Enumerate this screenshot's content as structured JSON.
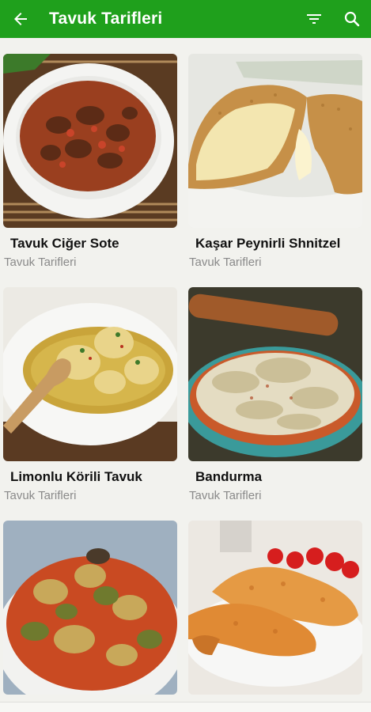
{
  "app_bar": {
    "title": "Tavuk Tarifleri",
    "background": "#1fa01c",
    "back_icon": "arrow-left-icon",
    "filter_icon": "filter-icon",
    "search_icon": "search-icon"
  },
  "recipes": [
    {
      "title": "Tavuk Ciğer Sote",
      "category": "Tavuk Tarifleri",
      "image": "liver-saute-photo"
    },
    {
      "title": "Kaşar Peynirli Shnitzel",
      "category": "Tavuk Tarifleri",
      "image": "cheese-schnitzel-photo"
    },
    {
      "title": "Limonlu Körili Tavuk",
      "category": "Tavuk Tarifleri",
      "image": "lemon-curry-chicken-photo"
    },
    {
      "title": "Bandurma",
      "category": "Tavuk Tarifleri",
      "image": "bandurma-photo"
    },
    {
      "title": "",
      "category": "",
      "image": "vegetable-stew-photo"
    },
    {
      "title": "",
      "category": "",
      "image": "fried-drumsticks-photo"
    }
  ]
}
